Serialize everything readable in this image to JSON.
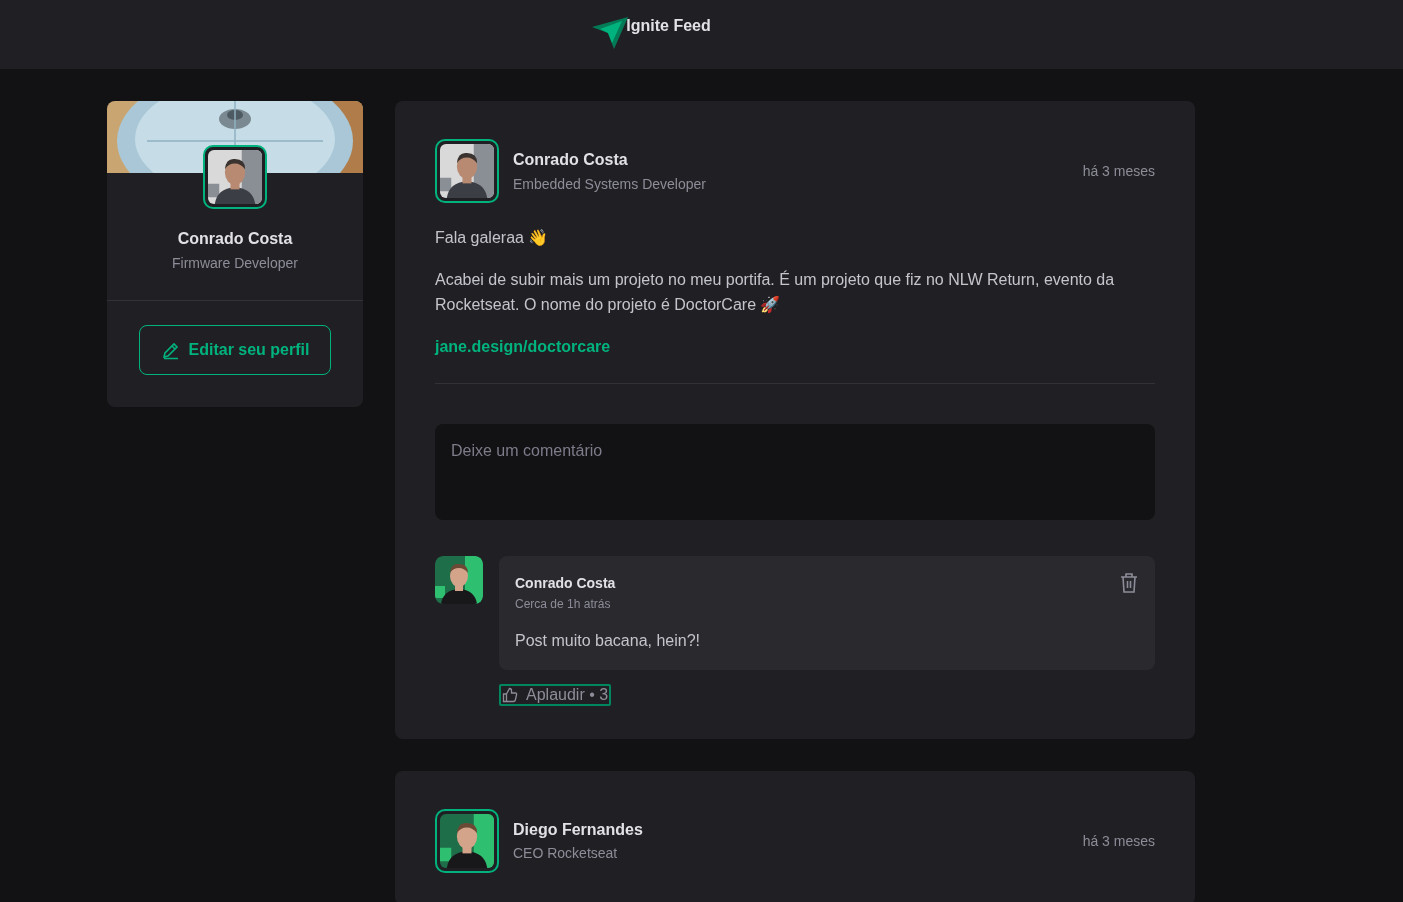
{
  "header": {
    "title": "Ignite Feed"
  },
  "profile": {
    "name": "Conrado Costa",
    "role": "Firmware Developer",
    "edit_button": "Editar seu perfil"
  },
  "posts": [
    {
      "author": "Conrado Costa",
      "role": "Embedded Systems Developer",
      "time": "há 3 meses",
      "content": [
        {
          "kind": "paragraph",
          "text": "Fala galeraa 👋"
        },
        {
          "kind": "paragraph",
          "text": "Acabei de subir mais um projeto no meu portifa. É um projeto que fiz no NLW Return, evento da Rocketseat. O nome do projeto é DoctorCare 🚀"
        },
        {
          "kind": "link",
          "text": "jane.design/doctorcare"
        }
      ],
      "comment_placeholder": "Deixe um comentário",
      "comments": [
        {
          "author": "Conrado Costa",
          "time": "Cerca de 1h atrás",
          "text": "Post muito bacana, hein?!",
          "applaud": "Aplaudir • 3",
          "focused": true
        }
      ]
    },
    {
      "author": "Diego Fernandes",
      "role": "CEO Rocketseat",
      "time": "há 3 meses"
    }
  ]
}
